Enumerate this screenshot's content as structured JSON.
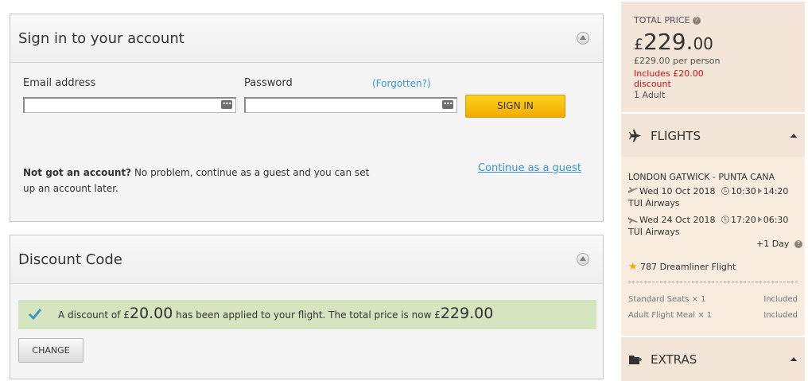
{
  "signin": {
    "title": "Sign in to your account",
    "email_label": "Email address",
    "email_value": "",
    "password_label": "Password",
    "password_value": "",
    "forgot_label": "(Forgotten?)",
    "signin_button": "SIGN IN",
    "no_account_bold": "Not got an account?",
    "no_account_text": " No problem, continue as a guest and you can set up an account later.",
    "guest_link": "Continue as a guest"
  },
  "discount": {
    "title": "Discount Code",
    "msg_prefix": "A discount of £",
    "msg_amount": "20.00",
    "msg_middle": " has been applied to your flight. The total price is now £",
    "msg_total": "229.00",
    "change_button": "CHANGE"
  },
  "summary": {
    "total_label": "TOTAL PRICE",
    "currency": "£",
    "price_int": "229.",
    "price_dec": "00",
    "per_person": "£229.00 per person",
    "discount_line1": "Includes £20.00",
    "discount_line2": "discount",
    "adults": "1 Adult"
  },
  "flights": {
    "title": "FLIGHTS",
    "route": "LONDON GATWICK - PUNTA CANA",
    "outbound_date": "Wed 10 Oct 2018",
    "outbound_dep": "10:30",
    "outbound_arr": "14:20",
    "outbound_airline": "TUI Airways",
    "return_date": "Wed 24 Oct 2018",
    "return_dep": "17:20",
    "return_arr": "06:30",
    "return_airline": "TUI Airways",
    "plus_day": "+1 Day",
    "aircraft": "787 Dreamliner Flight",
    "extras": [
      {
        "label": "Standard Seats × 1",
        "value": "Included"
      },
      {
        "label": "Adult Flight Meal × 1",
        "value": "Included"
      }
    ]
  },
  "extras_section": {
    "title": "EXTRAS"
  },
  "colors": {
    "accent_yellow": "#f2ab00",
    "link_blue": "#3a96c8",
    "success_bg": "#d6e5c0",
    "sidebar_bg": "#f3e5d7",
    "discount_red": "#cc1111"
  },
  "icons": [
    "collapse-icon",
    "password-manager-icon",
    "check-icon",
    "help-icon",
    "plane-icon",
    "clock-icon",
    "star-icon",
    "suitcase-plus-icon",
    "caret-up-icon"
  ]
}
